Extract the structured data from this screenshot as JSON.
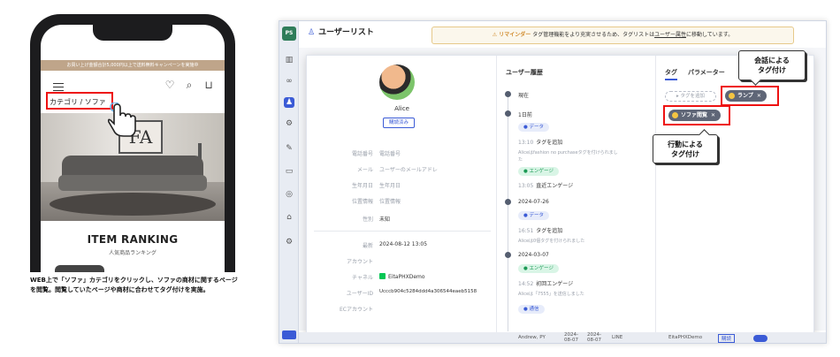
{
  "phone": {
    "promo": "お買い上げ金額合計5,000円以上で送料無料キャンペーンを実施中",
    "breadcrumb": "カテゴリ / ソファ",
    "hero_frame_text": "FA",
    "ranking_title": "ITEM RANKING",
    "ranking_sub": "人気商品ランキング",
    "icons": [
      "heart-icon",
      "search-icon",
      "cart-icon"
    ],
    "caption": "WEB上で「ソファ」カテゴリをクリックし、ソファの商材に関するページを閲覧。閲覧していたページや商材に合わせてタグ付けを実施。"
  },
  "app": {
    "logo": "PS",
    "page_title": "ユーザーリスト",
    "banner_warn": "⚠ リマインダー",
    "banner_text": "タグ管理機能をより充実させるため、タグリストは",
    "banner_link": "ユーザー属性",
    "banner_tail": "に移動しています。",
    "profile": {
      "name": "Alice",
      "badge": "購読済み",
      "fields": [
        {
          "label": "電話番号",
          "value": "電話番号"
        },
        {
          "label": "メール",
          "value": "ユーザーのメールアドレ"
        },
        {
          "label": "生年月日",
          "value": "生年月日"
        },
        {
          "label": "位置情報",
          "value": "位置情報"
        },
        {
          "label": "性別",
          "value": "未知"
        }
      ],
      "meta": [
        {
          "label": "最新",
          "value": "2024-08-12 13:05"
        },
        {
          "label": "アカウント",
          "value": ""
        },
        {
          "label": "チャネル",
          "value": "EitaPHXDemo"
        },
        {
          "label": "ユーザーID",
          "value": "Ucccb904c5284ddd4a306544eaeb5158"
        },
        {
          "label": "ECアカウント",
          "value": ""
        }
      ]
    },
    "history": {
      "title": "ユーザー履歴",
      "now": "現在",
      "day1": "1日前",
      "chip_data": "● データ",
      "ev1_time": "13:10",
      "ev1_title": "タグを追加",
      "ev1_desc": "Aliceはfashion no purchaseタグを付けられまし",
      "ev1_desc2": "た",
      "chip_eng": "● エンゲージ",
      "ev2_time": "13:05",
      "ev2_title": "直近エンゲージ",
      "date2": "2024-07-26",
      "ev3_time": "16:51",
      "ev3_title": "タグを追加",
      "ev3_desc": "Aliceは0個タグを付けられました",
      "date3": "2024-03-07",
      "ev4_time": "14:52",
      "ev4_title": "初回エンゲージ",
      "ev4_desc": "Aliceは「7555」を送信しました",
      "chip_push": "● 通信"
    },
    "tags": {
      "tab_tag": "タグ",
      "tab_param": "パラメーター",
      "add_tag": "タグを追加",
      "chip1": "ランプ",
      "chip2": "ソファ閲覧"
    },
    "callout_talk": "会話による\nタグ付け",
    "callout_act": "行動による\nタグ付け",
    "bottom": {
      "user": "Andrew, PY",
      "d1": "2024-\n08-07",
      "d2": "2024-\n08-07",
      "ch": "LINE",
      "acct": "EitaPHXDemo",
      "btn": "購読"
    }
  },
  "colors": {
    "accent": "#3b5bd6",
    "highlight": "#e11111",
    "tag_chip": "#5f6677",
    "engage": "#1c9a55"
  }
}
